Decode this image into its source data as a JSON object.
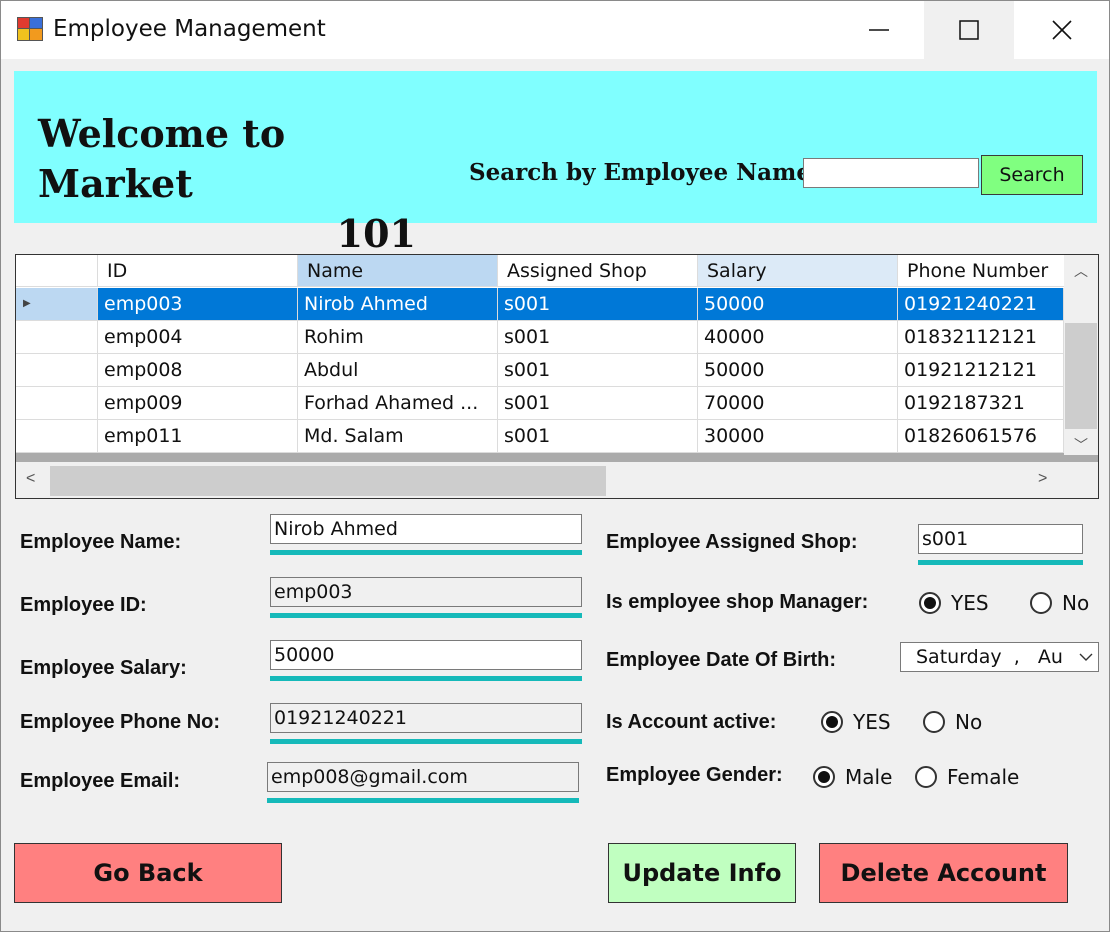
{
  "window": {
    "title": "Employee Management",
    "controls": [
      "minimize",
      "maximize",
      "close"
    ]
  },
  "banner": {
    "welcome_line1": "Welcome to Market",
    "welcome_line2": "101",
    "search_label": "Search by Employee Name",
    "search_value": "",
    "search_button": "Search",
    "background": "#80ffff"
  },
  "grid": {
    "columns": [
      "ID",
      "Name",
      "Assigned Shop",
      "Salary",
      "Phone Number"
    ],
    "rows": [
      {
        "id": "emp003",
        "name": "Nirob Ahmed",
        "shop": "s001",
        "salary": "50000",
        "phone": "01921240221",
        "selected": true
      },
      {
        "id": "emp004",
        "name": "Rohim",
        "shop": "s001",
        "salary": "40000",
        "phone": "01832112121"
      },
      {
        "id": "emp008",
        "name": "Abdul",
        "shop": "s001",
        "salary": "50000",
        "phone": "01921212121"
      },
      {
        "id": "emp009",
        "name": "Forhad Ahamed ...",
        "shop": "s001",
        "salary": "70000",
        "phone": "0192187321"
      },
      {
        "id": "emp011",
        "name": "Md. Salam",
        "shop": "s001",
        "salary": "30000",
        "phone": "01826061576"
      }
    ],
    "selection_color": "#0078d7"
  },
  "form": {
    "name_label": "Employee Name:",
    "name_value": "Nirob Ahmed",
    "id_label": "Employee ID:",
    "id_value": "emp003",
    "salary_label": "Employee Salary:",
    "salary_value": "50000",
    "phone_label": "Employee Phone No:",
    "phone_value": "01921240221",
    "email_label": "Employee Email:",
    "email_value": "emp008@gmail.com",
    "shop_label": "Employee Assigned Shop:",
    "shop_value": "s001",
    "manager_label": "Is employee shop Manager:",
    "manager_yes": "YES",
    "manager_no": "No",
    "manager_selected": "YES",
    "dob_label": "Employee Date Of Birth:",
    "dob_value": "Saturday  ,   Au",
    "active_label": "Is Account active:",
    "active_yes": "YES",
    "active_no": "No",
    "active_selected": "YES",
    "gender_label": "Employee Gender:",
    "gender_male": "Male",
    "gender_female": "Female",
    "gender_selected": "Male",
    "underline_color": "#15b9b9"
  },
  "buttons": {
    "go_back": "Go Back",
    "update": "Update Info",
    "delete": "Delete Account",
    "red_color": "#ff8080",
    "green_color": "#c0ffc0"
  }
}
